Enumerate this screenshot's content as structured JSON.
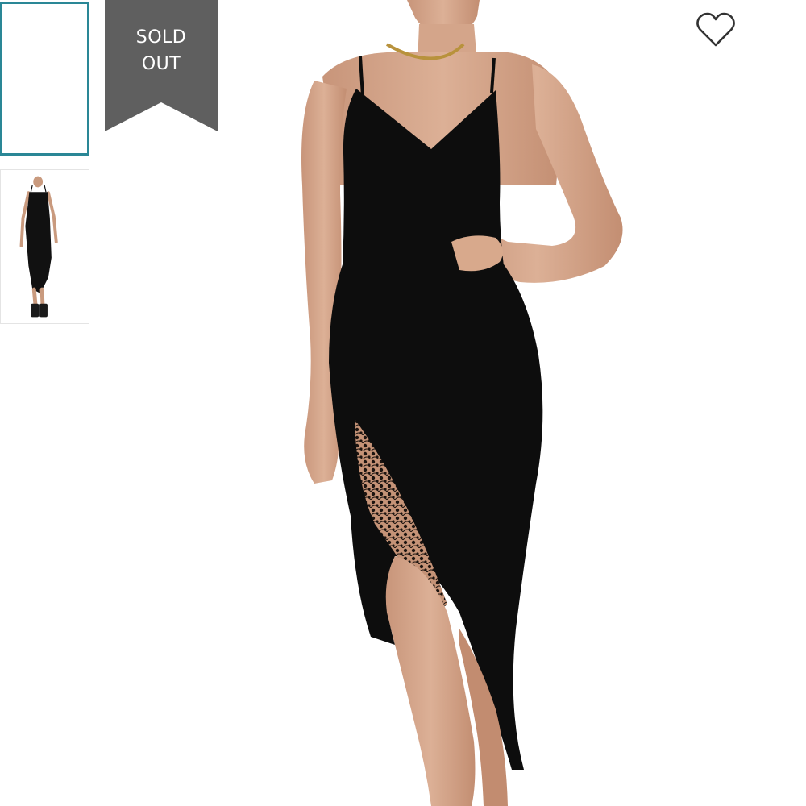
{
  "listing": {
    "status_badge": "SOLD\nOUT"
  },
  "gallery": {
    "thumbnails": [
      {
        "label": "",
        "selected": true
      },
      {
        "label": "",
        "selected": false
      }
    ]
  },
  "colors": {
    "selected_border": "#2a8796",
    "ribbon": "#5f5f5f",
    "dress": "#0d0d0d",
    "skin": "#d9a98a"
  },
  "icons": {
    "like": "heart-outline-icon"
  }
}
